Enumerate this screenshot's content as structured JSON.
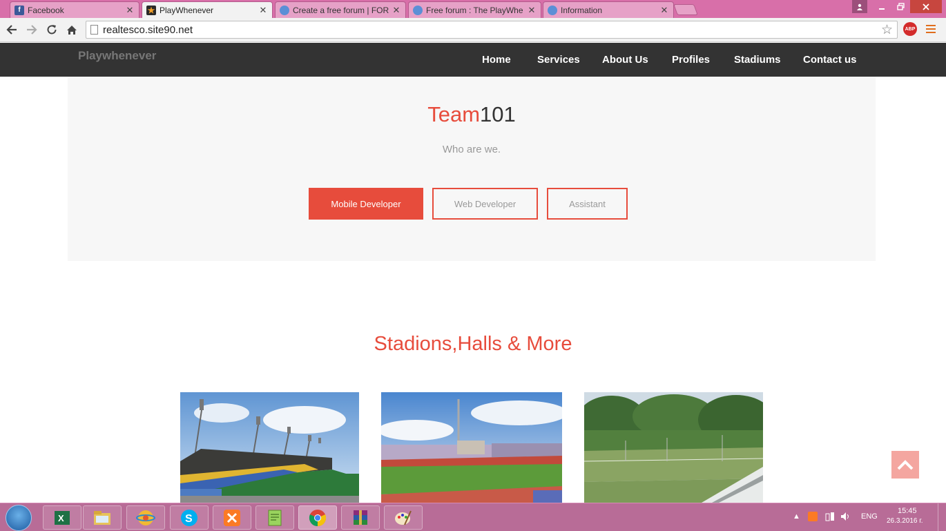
{
  "browser": {
    "tabs": [
      {
        "title": "Facebook",
        "icon": "facebook-icon"
      },
      {
        "title": "PlayWhenever",
        "icon": "playwhenever-icon"
      },
      {
        "title": "Create a free forum | FOR",
        "icon": "forum-icon"
      },
      {
        "title": "Free forum : The PlayWhe",
        "icon": "forum-icon"
      },
      {
        "title": "Information",
        "icon": "forum-icon"
      }
    ],
    "close_glyph": "✕",
    "url": "realtesco.site90.net",
    "abp_label": "ABP",
    "colors": {
      "tabstrip": "#d86fa9"
    }
  },
  "site": {
    "brand": "Playwhenever",
    "nav": [
      "Home",
      "Services",
      "About Us",
      "Profiles",
      "Stadiums",
      "Contact us"
    ]
  },
  "team": {
    "title_accent": "Team",
    "title_rest": "101",
    "subtitle": "Who are we.",
    "filters": [
      {
        "label": "Mobile Developer",
        "active": true
      },
      {
        "label": "Web Developer",
        "active": false
      },
      {
        "label": "Assistant",
        "active": false
      }
    ]
  },
  "stadiums": {
    "title": "Stadions,Halls & More",
    "photos": [
      "stadium-photo-1",
      "stadium-photo-2",
      "tennis-court-photo"
    ]
  },
  "taskbar": {
    "apps": [
      "start-orb",
      "excel-icon",
      "file-explorer-icon",
      "app-icon",
      "skype-icon",
      "xampp-icon",
      "notepad-icon",
      "chrome-icon",
      "winrar-icon",
      "paint-icon"
    ],
    "language": "ENG",
    "time": "15:45",
    "date": "26.3.2016 г."
  },
  "colors": {
    "accent": "#e74c3c",
    "nav_bg": "#333333",
    "taskbar": "#b86c97"
  }
}
